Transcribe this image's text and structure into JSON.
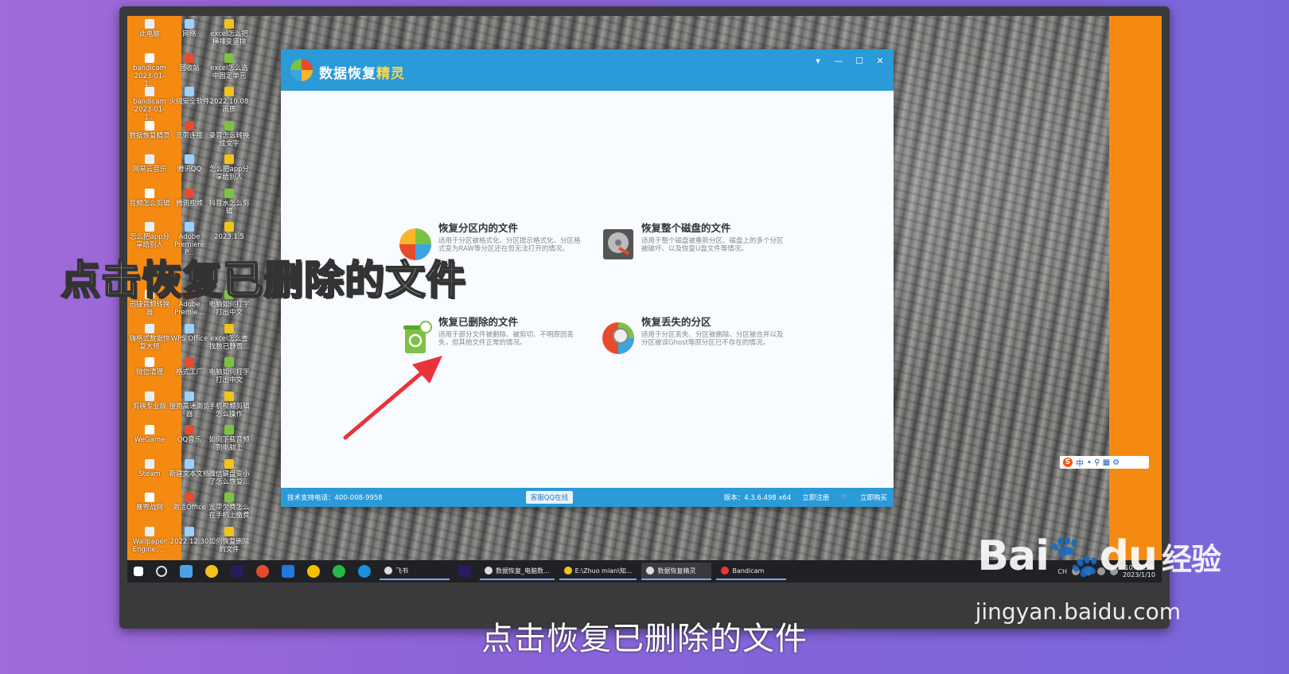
{
  "desktop": {
    "icons": [
      {
        "label": "此电脑",
        "col": 0,
        "row": 0
      },
      {
        "label": "网络",
        "col": 1,
        "row": 0
      },
      {
        "label": "excel怎么把横排变竖排",
        "col": 2,
        "row": 0
      },
      {
        "label": "bandicam 2023-01-1...",
        "col": 0,
        "row": 1
      },
      {
        "label": "回收站",
        "col": 1,
        "row": 1
      },
      {
        "label": "excel怎么选中固定单元",
        "col": 2,
        "row": 1
      },
      {
        "label": "bandicam 2023-01-1...",
        "col": 0,
        "row": 2
      },
      {
        "label": "火绒安全软件",
        "col": 1,
        "row": 2
      },
      {
        "label": "2022.10.08 画质",
        "col": 2,
        "row": 2
      },
      {
        "label": "数据恢复精灵",
        "col": 0,
        "row": 3
      },
      {
        "label": "宽带连接",
        "col": 1,
        "row": 3
      },
      {
        "label": "录音怎么转换成文字",
        "col": 2,
        "row": 3
      },
      {
        "label": "网易云音乐",
        "col": 0,
        "row": 4
      },
      {
        "label": "腾讯QQ",
        "col": 1,
        "row": 4
      },
      {
        "label": "怎么把app分享给别人",
        "col": 2,
        "row": 4
      },
      {
        "label": "音频怎么剪辑",
        "col": 0,
        "row": 5
      },
      {
        "label": "腾讯视频",
        "col": 1,
        "row": 5
      },
      {
        "label": "抖音水怎么剪辑",
        "col": 2,
        "row": 5
      },
      {
        "label": "怎么把app分享给别人",
        "col": 0,
        "row": 6
      },
      {
        "label": "Adobe Premiere P...",
        "col": 1,
        "row": 6
      },
      {
        "label": "2023.1.5",
        "col": 2,
        "row": 6
      },
      {
        "label": "迅捷音频转换器",
        "col": 0,
        "row": 8
      },
      {
        "label": "Adobe Premie...",
        "col": 1,
        "row": 8
      },
      {
        "label": "电脑如何打字打出中文",
        "col": 2,
        "row": 8
      },
      {
        "label": "嗨格式数据恢复大师",
        "col": 0,
        "row": 9
      },
      {
        "label": "WPS Office",
        "col": 1,
        "row": 9
      },
      {
        "label": "excel怎么查找数已静置...",
        "col": 2,
        "row": 9
      },
      {
        "label": "微信清理",
        "col": 0,
        "row": 10
      },
      {
        "label": "格式工厂",
        "col": 1,
        "row": 10
      },
      {
        "label": "电脑如何打字打出中文",
        "col": 2,
        "row": 10
      },
      {
        "label": "剪映专业版",
        "col": 0,
        "row": 11
      },
      {
        "label": "搜狗高速浏览器",
        "col": 1,
        "row": 11
      },
      {
        "label": "手机视频剪辑怎么操作",
        "col": 2,
        "row": 11
      },
      {
        "label": "WeGame",
        "col": 0,
        "row": 12
      },
      {
        "label": "QQ音乐",
        "col": 1,
        "row": 12
      },
      {
        "label": "如何下载音频到电脑上",
        "col": 2,
        "row": 12
      },
      {
        "label": "Steam",
        "col": 0,
        "row": 13
      },
      {
        "label": "新建文本文档",
        "col": 1,
        "row": 13
      },
      {
        "label": "微信键盘变小了怎么恢复...",
        "col": 2,
        "row": 13
      },
      {
        "label": "暴雪战网",
        "col": 0,
        "row": 14
      },
      {
        "label": "激活Office",
        "col": 1,
        "row": 14
      },
      {
        "label": "宽带欠费怎么在手机上缴费",
        "col": 2,
        "row": 14
      },
      {
        "label": "Wallpaper Engine: ...",
        "col": 0,
        "row": 15
      },
      {
        "label": "2022.12.30",
        "col": 1,
        "row": 15
      },
      {
        "label": "如何恢复删除的文件",
        "col": 2,
        "row": 15
      }
    ]
  },
  "app": {
    "title_main": "数据恢复",
    "title_highlight": "精灵",
    "window_buttons": [
      "▾",
      "—",
      "☐",
      "✕"
    ],
    "options": [
      {
        "name": "恢复分区内的文件",
        "desc": "适用于分区被格式化、分区提示格式化、分区格式变为RAW等分区还在但无法打开的情况。"
      },
      {
        "name": "恢复整个磁盘的文件",
        "desc": "适用于整个磁盘被重新分区、磁盘上的多个分区被破坏、以及恢复U盘文件等情况。"
      },
      {
        "name": "恢复已删除的文件",
        "desc": "适用于部分文件被删除、被剪切、不明原因丢失，但其他文件正常的情况。"
      },
      {
        "name": "恢复丢失的分区",
        "desc": "适用于分区丢失、分区被删除、分区被合并以及分区被误Ghost等原分区已不存在的情况。"
      }
    ],
    "footer": {
      "support": "技术支持电话：400-008-9958",
      "qq": "客服QQ在线",
      "version": "版本：4.3.6.498 x64",
      "register": "立即注册",
      "buy": "立即购买"
    }
  },
  "ime": {
    "logo": "S",
    "mode": "中"
  },
  "taskbar": {
    "tasks": [
      "飞书",
      "数据恢复_电脑数...",
      "E:\\Zhuo mian\\知...",
      "数据恢复精灵",
      "Bandicam"
    ],
    "tray_text": "CH",
    "time": "10:04:30",
    "date": "2023/1/10"
  },
  "overlay": {
    "caption_big": "点击恢复已删除的文件",
    "caption_sub": "点击恢复已删除的文件",
    "watermark_brand": "Bai",
    "watermark_du": "du",
    "watermark_suffix": "经验",
    "watermark_url": "jingyan.baidu.com"
  }
}
